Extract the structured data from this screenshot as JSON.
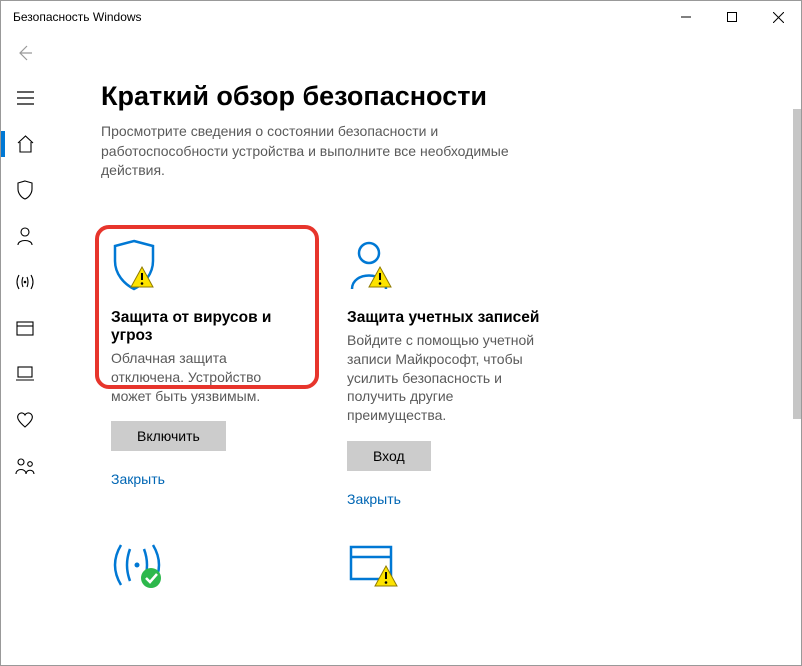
{
  "window": {
    "title": "Безопасность Windows"
  },
  "page": {
    "heading": "Краткий обзор безопасности",
    "description": "Просмотрите сведения о состоянии безопасности и работоспособности устройства и выполните все необходимые действия."
  },
  "cards": {
    "virus": {
      "title": "Защита от вирусов и угроз",
      "body": "Облачная защита отключена. Устройство может быть уязвимым.",
      "action": "Включить",
      "dismiss": "Закрыть"
    },
    "account": {
      "title": "Защита учетных записей",
      "body": "Войдите с помощью учетной записи Майкрософт, чтобы усилить безопасность и получить другие преимущества.",
      "action": "Вход",
      "dismiss": "Закрыть"
    }
  }
}
